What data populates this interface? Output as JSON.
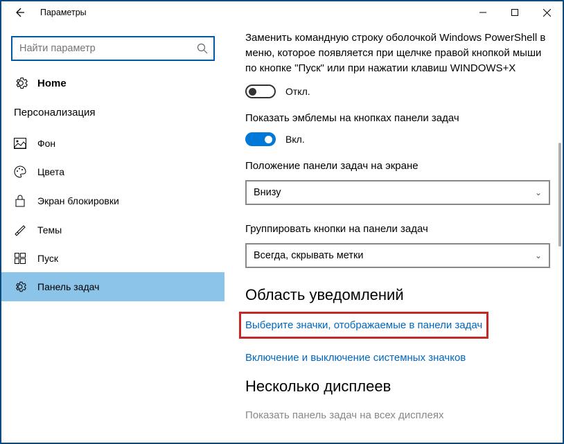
{
  "window": {
    "title": "Параметры"
  },
  "sidebar": {
    "search_placeholder": "Найти параметр",
    "home": "Home",
    "category": "Персонализация",
    "items": [
      {
        "label": "Фон"
      },
      {
        "label": "Цвета"
      },
      {
        "label": "Экран блокировки"
      },
      {
        "label": "Темы"
      },
      {
        "label": "Пуск"
      },
      {
        "label": "Панель задач"
      }
    ]
  },
  "main": {
    "powershell_desc": "Заменить командную строку оболочкой Windows PowerShell в меню, которое появляется при щелчке правой кнопкой мыши по кнопке \"Пуск\" или при нажатии клавиш WINDOWS+X",
    "off_label": "Откл.",
    "emblems_label": "Показать эмблемы на кнопках панели задач",
    "on_label": "Вкл.",
    "position_label": "Положение панели задач на экране",
    "position_value": "Внизу",
    "group_label": "Группировать кнопки на панели задач",
    "group_value": "Всегда, скрывать метки",
    "notif_section": "Область уведомлений",
    "link_icons": "Выберите значки, отображаемые в панели задач",
    "link_sysicons": "Включение и выключение системных значков",
    "multi_section": "Несколько дисплеев",
    "multi_desc": "Показать панель задач на всех дисплеях"
  }
}
